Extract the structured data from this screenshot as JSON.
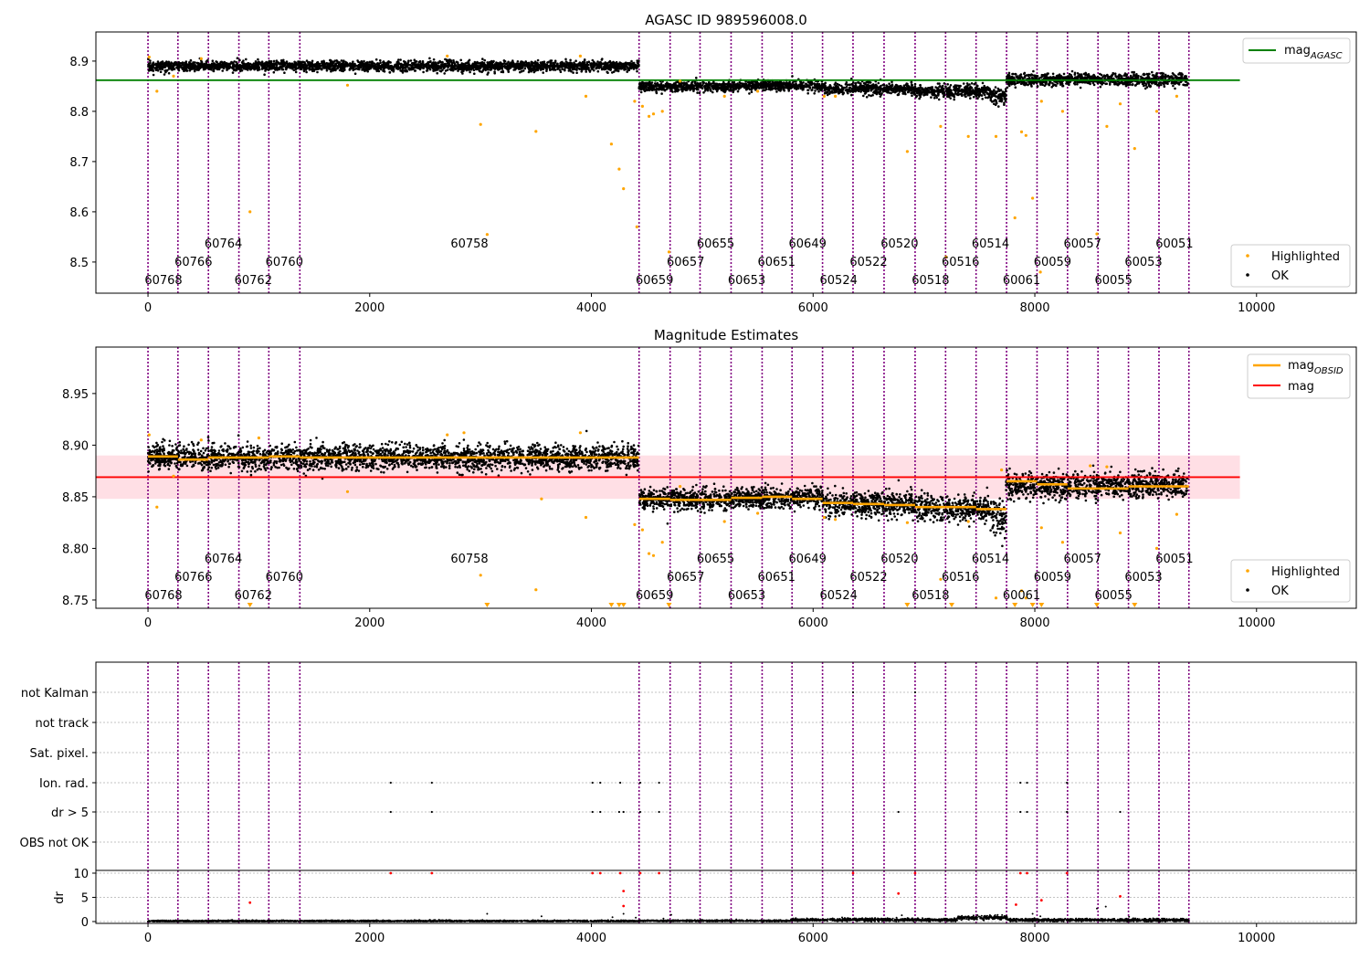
{
  "colors": {
    "ok": "#000000",
    "highlighted": "#ffa500",
    "mag_agasc_line": "#008000",
    "mag_line": "#ff0000",
    "mag_obsid": "#ffa500",
    "obs_boundary": "#800080",
    "band": "#ffc0cb",
    "flag_red": "#ff0000"
  },
  "chart_data": [
    {
      "type": "scatter",
      "title": "AGASC ID 989596008.0",
      "xlabel": "",
      "ylabel": "",
      "xlim": [
        -470,
        10900
      ],
      "ylim": [
        8.438,
        8.958
      ],
      "x_ticks": [
        0,
        2000,
        4000,
        6000,
        8000,
        10000
      ],
      "y_ticks": [
        8.5,
        8.6,
        8.7,
        8.8,
        8.9
      ],
      "legend_top": {
        "position": "top-right",
        "entries": [
          {
            "label": "mag",
            "sub": "AGASC",
            "color": "#008000"
          }
        ]
      },
      "legend_bottom": {
        "position": "bottom-right",
        "entries": [
          "Highlighted",
          "OK"
        ]
      },
      "mag_agasc": 8.862,
      "mag_agasc_x_range": [
        -470,
        9850
      ],
      "series": [
        {
          "name": "OK",
          "color": "#000000",
          "segments": [
            {
              "x0": 0,
              "x1": 4430,
              "mean": 8.89,
              "sd": 0.005
            },
            {
              "x0": 4430,
              "x1": 5300,
              "mean": 8.849,
              "sd": 0.005
            },
            {
              "x0": 5300,
              "x1": 6100,
              "mean": 8.851,
              "sd": 0.005
            },
            {
              "x0": 6100,
              "x1": 6900,
              "mean": 8.845,
              "sd": 0.006
            },
            {
              "x0": 6900,
              "x1": 7600,
              "mean": 8.84,
              "sd": 0.006
            },
            {
              "x0": 7600,
              "x1": 7740,
              "mean": 8.83,
              "sd": 0.008
            },
            {
              "x0": 7740,
              "x1": 9380,
              "mean": 8.863,
              "sd": 0.006
            }
          ]
        },
        {
          "name": "Highlighted",
          "color": "#ffa500",
          "points": [
            [
              10,
              8.908
            ],
            [
              80,
              8.84
            ],
            [
              230,
              8.87
            ],
            [
              480,
              8.905
            ],
            [
              920,
              8.6
            ],
            [
              1800,
              8.852
            ],
            [
              2700,
              8.91
            ],
            [
              3000,
              8.774
            ],
            [
              3060,
              8.555
            ],
            [
              3500,
              8.76
            ],
            [
              3950,
              8.83
            ],
            [
              3900,
              8.91
            ],
            [
              4180,
              8.735
            ],
            [
              4250,
              8.685
            ],
            [
              4290,
              8.646
            ],
            [
              4390,
              8.82
            ],
            [
              4410,
              8.57
            ],
            [
              4460,
              8.81
            ],
            [
              4520,
              8.79
            ],
            [
              4560,
              8.795
            ],
            [
              4640,
              8.8
            ],
            [
              4700,
              8.52
            ],
            [
              4800,
              8.86
            ],
            [
              5200,
              8.83
            ],
            [
              5500,
              8.84
            ],
            [
              6100,
              8.83
            ],
            [
              6200,
              8.83
            ],
            [
              6850,
              8.72
            ],
            [
              7200,
              8.51
            ],
            [
              7150,
              8.77
            ],
            [
              7400,
              8.75
            ],
            [
              7650,
              8.75
            ],
            [
              7820,
              8.588
            ],
            [
              7880,
              8.759
            ],
            [
              7920,
              8.752
            ],
            [
              7980,
              8.627
            ],
            [
              8050,
              8.48
            ],
            [
              8060,
              8.82
            ],
            [
              8250,
              8.8
            ],
            [
              8560,
              8.556
            ],
            [
              8650,
              8.77
            ],
            [
              8770,
              8.815
            ],
            [
              8900,
              8.726
            ],
            [
              9100,
              8.8
            ],
            [
              9280,
              8.83
            ]
          ]
        }
      ],
      "obs_boundaries": [
        0,
        270,
        545,
        820,
        1090,
        1370,
        4430,
        4710,
        4980,
        5260,
        5540,
        5810,
        6085,
        6360,
        6640,
        6920,
        7195,
        7470,
        7745,
        8020,
        8295,
        8570,
        8845,
        9120,
        9390
      ],
      "obs_labels": [
        {
          "x": 140,
          "row": 3,
          "text": "60768"
        },
        {
          "x": 410,
          "row": 2,
          "text": "60766"
        },
        {
          "x": 680,
          "row": 1,
          "text": "60764"
        },
        {
          "x": 950,
          "row": 3,
          "text": "60762"
        },
        {
          "x": 1230,
          "row": 2,
          "text": "60760"
        },
        {
          "x": 2900,
          "row": 1,
          "text": "60758"
        },
        {
          "x": 4570,
          "row": 3,
          "text": "60659"
        },
        {
          "x": 4850,
          "row": 2,
          "text": "60657"
        },
        {
          "x": 5120,
          "row": 1,
          "text": "60655"
        },
        {
          "x": 5400,
          "row": 3,
          "text": "60653"
        },
        {
          "x": 5670,
          "row": 2,
          "text": "60651"
        },
        {
          "x": 5950,
          "row": 1,
          "text": "60649"
        },
        {
          "x": 6230,
          "row": 3,
          "text": "60524"
        },
        {
          "x": 6500,
          "row": 2,
          "text": "60522"
        },
        {
          "x": 6780,
          "row": 1,
          "text": "60520"
        },
        {
          "x": 7060,
          "row": 3,
          "text": "60518"
        },
        {
          "x": 7330,
          "row": 2,
          "text": "60516"
        },
        {
          "x": 7600,
          "row": 1,
          "text": "60514"
        },
        {
          "x": 7880,
          "row": 3,
          "text": "60061"
        },
        {
          "x": 8160,
          "row": 2,
          "text": "60059"
        },
        {
          "x": 8430,
          "row": 1,
          "text": "60057"
        },
        {
          "x": 8710,
          "row": 3,
          "text": "60055"
        },
        {
          "x": 8980,
          "row": 2,
          "text": "60053"
        },
        {
          "x": 9260,
          "row": 1,
          "text": "60051"
        }
      ]
    },
    {
      "type": "scatter",
      "title": "Magnitude Estimates",
      "xlabel": "",
      "ylabel": "",
      "xlim": [
        -470,
        10900
      ],
      "ylim": [
        8.742,
        8.995
      ],
      "x_ticks": [
        0,
        2000,
        4000,
        6000,
        8000,
        10000
      ],
      "y_ticks": [
        8.75,
        8.8,
        8.85,
        8.9,
        8.95
      ],
      "legend_top": {
        "position": "top-right",
        "entries": [
          {
            "label": "mag",
            "sub": "OBSID",
            "color": "#ffa500"
          },
          {
            "label": "mag",
            "sub": "",
            "color": "#ff0000"
          }
        ]
      },
      "legend_bottom": {
        "position": "bottom-right",
        "entries": [
          "Highlighted",
          "OK"
        ]
      },
      "mag": 8.869,
      "mag_band": [
        8.848,
        8.89
      ],
      "mag_x_range": [
        -470,
        9850
      ],
      "mag_obsid": [
        {
          "x0": 0,
          "x1": 270,
          "y": 8.889
        },
        {
          "x0": 270,
          "x1": 545,
          "y": 8.886
        },
        {
          "x0": 545,
          "x1": 820,
          "y": 8.888
        },
        {
          "x0": 820,
          "x1": 1090,
          "y": 8.888
        },
        {
          "x0": 1090,
          "x1": 1370,
          "y": 8.889
        },
        {
          "x0": 1370,
          "x1": 4430,
          "y": 8.888
        },
        {
          "x0": 4430,
          "x1": 4710,
          "y": 8.848
        },
        {
          "x0": 4710,
          "x1": 4980,
          "y": 8.847
        },
        {
          "x0": 4980,
          "x1": 5260,
          "y": 8.847
        },
        {
          "x0": 5260,
          "x1": 5540,
          "y": 8.849
        },
        {
          "x0": 5540,
          "x1": 5810,
          "y": 8.85
        },
        {
          "x0": 5810,
          "x1": 6085,
          "y": 8.848
        },
        {
          "x0": 6085,
          "x1": 6360,
          "y": 8.844
        },
        {
          "x0": 6360,
          "x1": 6640,
          "y": 8.843
        },
        {
          "x0": 6640,
          "x1": 6920,
          "y": 8.842
        },
        {
          "x0": 6920,
          "x1": 7195,
          "y": 8.84
        },
        {
          "x0": 7195,
          "x1": 7470,
          "y": 8.84
        },
        {
          "x0": 7470,
          "x1": 7745,
          "y": 8.838
        },
        {
          "x0": 7745,
          "x1": 8020,
          "y": 8.865
        },
        {
          "x0": 8020,
          "x1": 8295,
          "y": 8.862
        },
        {
          "x0": 8295,
          "x1": 8570,
          "y": 8.858
        },
        {
          "x0": 8570,
          "x1": 8845,
          "y": 8.858
        },
        {
          "x0": 8845,
          "x1": 9120,
          "y": 8.86
        },
        {
          "x0": 9120,
          "x1": 9390,
          "y": 8.86
        }
      ],
      "series": [
        {
          "name": "OK",
          "color": "#000000",
          "segments": [
            {
              "x0": 0,
              "x1": 4430,
              "mean": 8.888,
              "sd": 0.006
            },
            {
              "x0": 4430,
              "x1": 5300,
              "mean": 8.848,
              "sd": 0.005
            },
            {
              "x0": 5300,
              "x1": 6100,
              "mean": 8.849,
              "sd": 0.005
            },
            {
              "x0": 6100,
              "x1": 6900,
              "mean": 8.843,
              "sd": 0.006
            },
            {
              "x0": 6900,
              "x1": 7600,
              "mean": 8.839,
              "sd": 0.006
            },
            {
              "x0": 7600,
              "x1": 7740,
              "mean": 8.83,
              "sd": 0.009
            },
            {
              "x0": 7740,
              "x1": 9380,
              "mean": 8.861,
              "sd": 0.006
            }
          ]
        },
        {
          "name": "Highlighted",
          "color": "#ffa500",
          "points": [
            [
              10,
              8.91
            ],
            [
              80,
              8.84
            ],
            [
              230,
              8.87
            ],
            [
              480,
              8.905
            ],
            [
              1000,
              8.907
            ],
            [
              1800,
              8.855
            ],
            [
              2700,
              8.91
            ],
            [
              2850,
              8.912
            ],
            [
              3000,
              8.774
            ],
            [
              3500,
              8.76
            ],
            [
              3550,
              8.848
            ],
            [
              3900,
              8.912
            ],
            [
              3950,
              8.83
            ],
            [
              4390,
              8.823
            ],
            [
              4460,
              8.818
            ],
            [
              4520,
              8.795
            ],
            [
              4560,
              8.793
            ],
            [
              4640,
              8.806
            ],
            [
              4800,
              8.86
            ],
            [
              5200,
              8.826
            ],
            [
              5500,
              8.834
            ],
            [
              6100,
              8.83
            ],
            [
              6200,
              8.828
            ],
            [
              6850,
              8.825
            ],
            [
              7150,
              8.77
            ],
            [
              7400,
              8.826
            ],
            [
              7650,
              8.752
            ],
            [
              7700,
              8.876
            ],
            [
              7880,
              8.759
            ],
            [
              7920,
              8.752
            ],
            [
              8060,
              8.82
            ],
            [
              8250,
              8.806
            ],
            [
              8500,
              8.88
            ],
            [
              8650,
              8.879
            ],
            [
              8770,
              8.815
            ],
            [
              9100,
              8.8
            ],
            [
              9280,
              8.833
            ]
          ]
        },
        {
          "name": "Highlighted-clipped",
          "color": "#ffa500",
          "x": [
            920,
            3060,
            4180,
            4250,
            4290,
            4700,
            6850,
            7250,
            7820,
            7980,
            8060,
            8560,
            8900
          ]
        }
      ],
      "obs_boundaries": [
        0,
        270,
        545,
        820,
        1090,
        1370,
        4430,
        4710,
        4980,
        5260,
        5540,
        5810,
        6085,
        6360,
        6640,
        6920,
        7195,
        7470,
        7745,
        8020,
        8295,
        8570,
        8845,
        9120,
        9390
      ]
    },
    {
      "type": "scatter",
      "title": "",
      "xlabel": "",
      "ylabel": "dr",
      "xlim": [
        -470,
        10900
      ],
      "x_ticks": [
        0,
        2000,
        4000,
        6000,
        8000,
        10000
      ],
      "flag_categories": [
        "not Kalman",
        "not track",
        "Sat. pixel.",
        "Ion. rad.",
        "dr > 5",
        "OBS not OK"
      ],
      "dr_ylim": [
        -0.5,
        10.5
      ],
      "dr_ticks": [
        0,
        5,
        10
      ],
      "flags": {
        "not Kalman": [
          6360,
          6920
        ],
        "not track": [],
        "Sat. pixel.": [],
        "Ion. rad.": [
          2190,
          2560,
          4010,
          4080,
          4260,
          4440,
          4610,
          7870,
          7930,
          8290
        ],
        "dr > 5": [
          2190,
          2560,
          4010,
          4080,
          4250,
          4290,
          4440,
          4610,
          6770,
          7870,
          7930,
          8290,
          8770
        ],
        "OBS not OK": []
      },
      "dr_points_large": [
        [
          920,
          3.9
        ],
        [
          2190,
          10
        ],
        [
          2560,
          10
        ],
        [
          4010,
          10
        ],
        [
          4080,
          10
        ],
        [
          4260,
          10
        ],
        [
          4290,
          6.3
        ],
        [
          4290,
          3.2
        ],
        [
          4440,
          10
        ],
        [
          4610,
          10
        ],
        [
          6360,
          10
        ],
        [
          6770,
          5.8
        ],
        [
          6920,
          10
        ],
        [
          7830,
          3.5
        ],
        [
          7870,
          10
        ],
        [
          7930,
          10
        ],
        [
          8060,
          4.4
        ],
        [
          8290,
          10
        ],
        [
          8770,
          5.2
        ]
      ],
      "dr_points_small": [
        [
          1800,
          0.2
        ],
        [
          3060,
          1.6
        ],
        [
          3550,
          1.1
        ],
        [
          4190,
          0.9
        ],
        [
          4290,
          1.6
        ],
        [
          4400,
          0.8
        ],
        [
          4650,
          0.6
        ],
        [
          4720,
          1.4
        ],
        [
          6800,
          1.3
        ],
        [
          7050,
          0.5
        ],
        [
          7980,
          1.6
        ],
        [
          8050,
          1.1
        ],
        [
          8560,
          2.7
        ],
        [
          8640,
          3.1
        ],
        [
          8850,
          1.0
        ],
        [
          9100,
          0.6
        ],
        [
          9290,
          0.4
        ]
      ],
      "dr_band_segments": [
        {
          "x0": 0,
          "x1": 4430,
          "mean": 0.1,
          "sd": 0.08
        },
        {
          "x0": 4430,
          "x1": 5800,
          "mean": 0.15,
          "sd": 0.08
        },
        {
          "x0": 5800,
          "x1": 7300,
          "mean": 0.35,
          "sd": 0.15
        },
        {
          "x0": 7300,
          "x1": 7750,
          "mean": 0.8,
          "sd": 0.2
        },
        {
          "x0": 7750,
          "x1": 9390,
          "mean": 0.3,
          "sd": 0.15
        }
      ],
      "obs_boundaries": [
        0,
        270,
        545,
        820,
        1090,
        1370,
        4430,
        4710,
        4980,
        5260,
        5540,
        5810,
        6085,
        6360,
        6640,
        6920,
        7195,
        7470,
        7745,
        8020,
        8295,
        8570,
        8845,
        9120,
        9390
      ]
    }
  ]
}
